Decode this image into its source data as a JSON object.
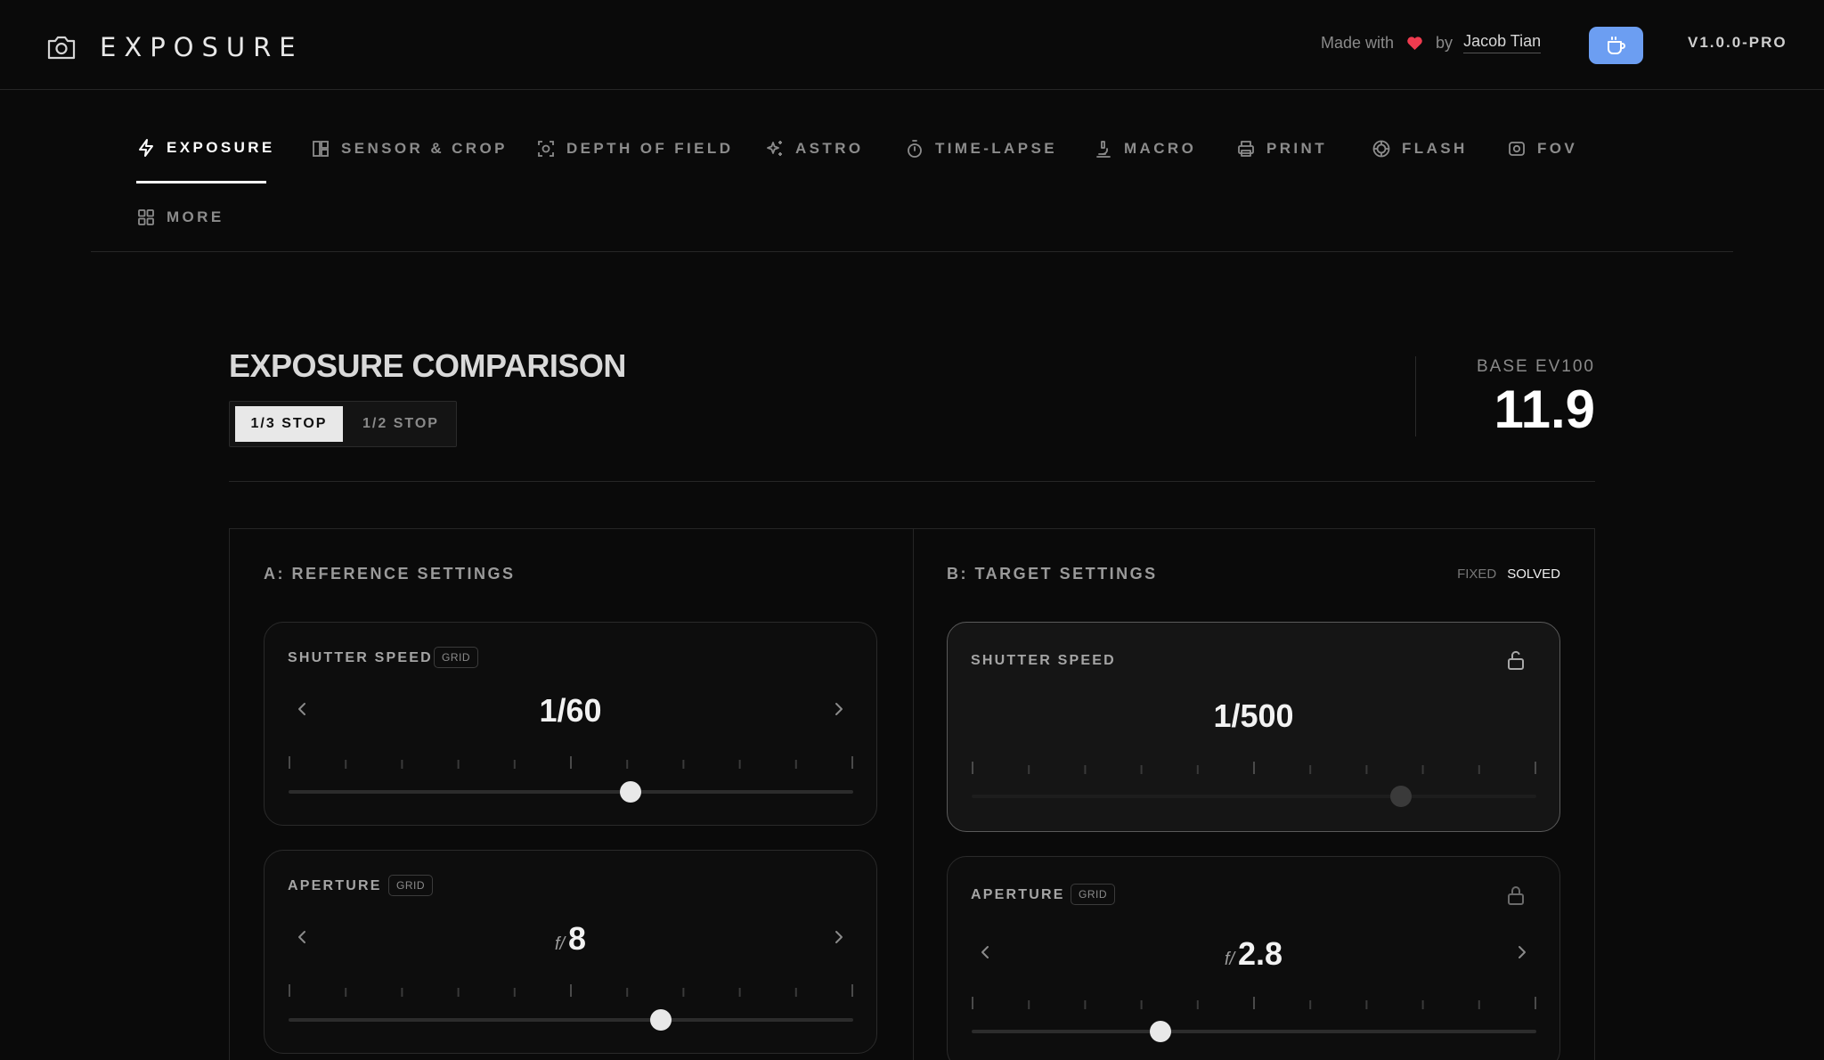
{
  "header": {
    "app_title": "EXPOSURE",
    "credit_prefix": "Made with",
    "credit_by": "by",
    "credit_author": "Jacob Tian",
    "version": "V1.0.0-PRO",
    "accent_color": "#6c9ef2",
    "heart_color": "#ef3b4f"
  },
  "tabs": [
    {
      "label": "EXPOSURE",
      "icon": "lightning-icon",
      "active": true
    },
    {
      "label": "SENSOR & CROP",
      "icon": "sensor-icon",
      "active": false
    },
    {
      "label": "DEPTH OF FIELD",
      "icon": "focus-icon",
      "active": false
    },
    {
      "label": "ASTRO",
      "icon": "sparkles-icon",
      "active": false
    },
    {
      "label": "TIME-LAPSE",
      "icon": "timer-icon",
      "active": false
    },
    {
      "label": "MACRO",
      "icon": "microscope-icon",
      "active": false
    },
    {
      "label": "PRINT",
      "icon": "printer-icon",
      "active": false
    },
    {
      "label": "FLASH",
      "icon": "aperture-icon",
      "active": false
    },
    {
      "label": "FOV",
      "icon": "view-icon",
      "active": false
    },
    {
      "label": "MORE",
      "icon": "grid-icon",
      "active": false
    }
  ],
  "comparison": {
    "title": "EXPOSURE COMPARISON",
    "stop_options": [
      "1/3 STOP",
      "1/2 STOP"
    ],
    "selected_stop": "1/3 STOP",
    "base_ev_label": "BASE EV100",
    "base_ev_value": "11.9"
  },
  "reference": {
    "title": "A: REFERENCE SETTINGS",
    "shutter": {
      "label": "SHUTTER SPEED",
      "badge": "GRID",
      "value": "1/60",
      "slider_fraction": 0.605
    },
    "aperture": {
      "label": "APERTURE",
      "badge": "GRID",
      "prefix": "f/",
      "value": "8",
      "slider_fraction": 0.66
    }
  },
  "target": {
    "title": "B: TARGET SETTINGS",
    "mode_fixed": "FIXED",
    "mode_solved": "SOLVED",
    "shutter": {
      "label": "SHUTTER SPEED",
      "value": "1/500",
      "slider_fraction": 0.76,
      "icon": "unlock-icon"
    },
    "aperture": {
      "label": "APERTURE",
      "badge": "GRID",
      "prefix": "f/",
      "value": "2.8",
      "slider_fraction": 0.335,
      "icon": "lock-icon"
    }
  }
}
